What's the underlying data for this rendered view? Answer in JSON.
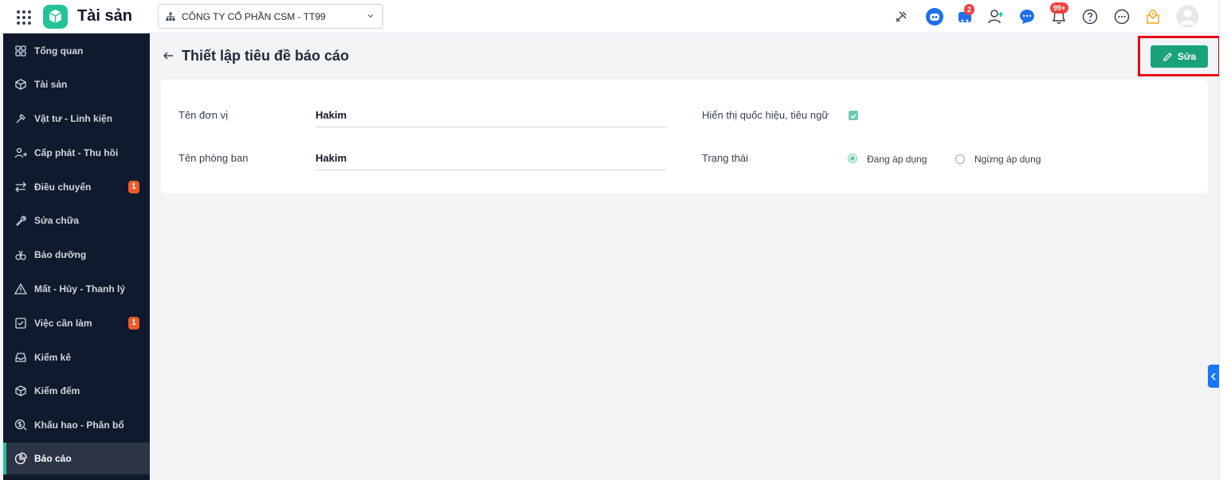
{
  "app": {
    "title": "Tài sản",
    "company": "CÔNG TY CỔ PHẦN CSM - TT99"
  },
  "topbar": {
    "icons": [
      "tools-icon",
      "bot-icon",
      "cart-icon",
      "add-user-icon",
      "chat-icon",
      "bell-icon",
      "help-icon",
      "more-icon",
      "location-icon",
      "avatar"
    ],
    "cart_badge": "2",
    "bell_badge": "99+"
  },
  "sidebar": {
    "items": [
      {
        "label": "Tổng quan",
        "icon": "grid-icon"
      },
      {
        "label": "Tài sản",
        "icon": "cube-icon"
      },
      {
        "label": "Vật tư - Linh kiện",
        "icon": "tool-icon"
      },
      {
        "label": "Cấp phát - Thu hồi",
        "icon": "user-arrow-icon"
      },
      {
        "label": "Điều chuyển",
        "icon": "transfer-icon",
        "badge": "1"
      },
      {
        "label": "Sửa chữa",
        "icon": "wrench-icon"
      },
      {
        "label": "Bảo dưỡng",
        "icon": "maintenance-icon"
      },
      {
        "label": "Mất - Hủy - Thanh lý",
        "icon": "warning-icon"
      },
      {
        "label": "Việc cần làm",
        "icon": "checkbox-icon",
        "badge": "1"
      },
      {
        "label": "Kiểm kê",
        "icon": "inbox-icon"
      },
      {
        "label": "Kiểm đếm",
        "icon": "box-icon"
      },
      {
        "label": "Khấu hao - Phân bổ",
        "icon": "dollar-icon"
      },
      {
        "label": "Báo cáo",
        "icon": "pie-chart-icon",
        "active": true
      }
    ]
  },
  "page": {
    "title": "Thiết lập tiêu đề báo cáo",
    "edit_label": "Sửa"
  },
  "form": {
    "unit_name_label": "Tên đơn vị",
    "unit_name_value": "Hakim",
    "dept_name_label": "Tên phòng ban",
    "dept_name_value": "Hakim",
    "show_motto_label": "Hiển thị quốc hiệu, tiêu ngữ",
    "show_motto_checked": true,
    "status_label": "Trạng thái",
    "status_options": [
      "Đang áp dụng",
      "Ngừng áp dụng"
    ],
    "status_selected": "Đang áp dụng"
  },
  "colors": {
    "brand": "#22c497",
    "sidebar_bg": "#0f1a2e",
    "edit_button": "#1aa37a",
    "highlight": "#e50914"
  }
}
